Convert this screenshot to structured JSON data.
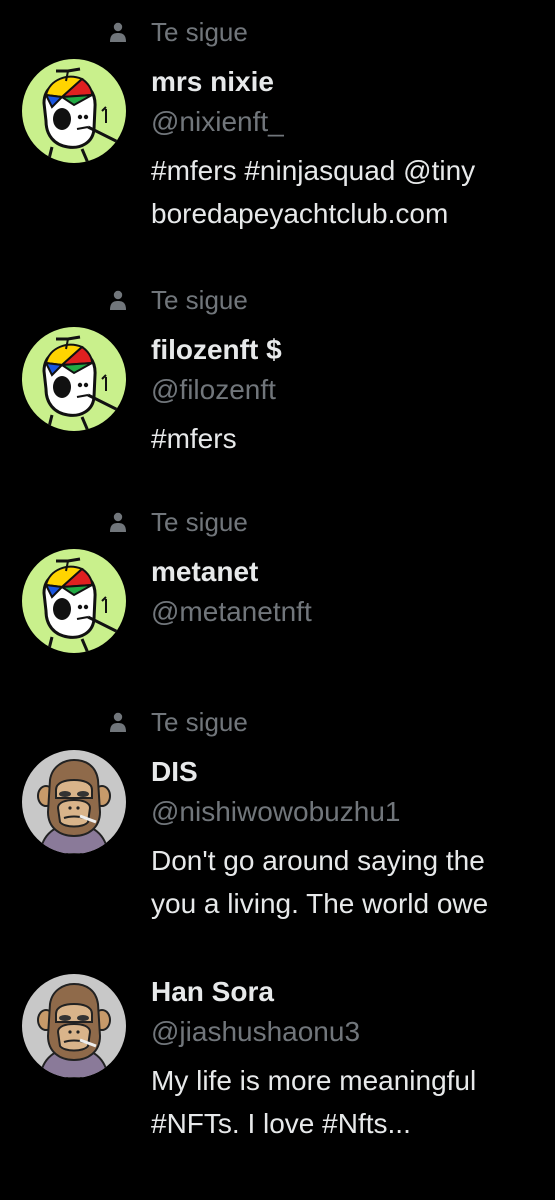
{
  "follows_label": "Te sigue",
  "colors": {
    "background": "#000000",
    "primary_text": "#e7e9ea",
    "secondary_text": "#71767b",
    "mfer_avatar_bg": "#c9f08c",
    "ape_avatar_bg": "#c8c8c8"
  },
  "users": [
    {
      "name": "mrs nixie",
      "handle": "@nixienft_",
      "bio_lines": [
        "#mfers #ninjasquad @tiny",
        "boredapeyachtclub.com"
      ],
      "follows_you": true,
      "avatar": "mfer-avatar"
    },
    {
      "name": "filozenft $",
      "handle": "@filozenft",
      "bio_lines": [
        "#mfers"
      ],
      "follows_you": true,
      "avatar": "mfer-avatar"
    },
    {
      "name": "metanet",
      "handle": "@metanetnft",
      "bio_lines": [],
      "follows_you": true,
      "avatar": "mfer-avatar"
    },
    {
      "name": "DIS",
      "handle": "@nishiwowobuzhu1",
      "bio_lines": [
        "Don't go around saying the",
        "you a living. The world owe"
      ],
      "follows_you": true,
      "avatar": "ape-avatar"
    },
    {
      "name": "Han Sora",
      "handle": "@jiashushaonu3",
      "bio_lines": [
        "My life is more meaningful",
        "#NFTs. I love #Nfts..."
      ],
      "follows_you": false,
      "avatar": "ape-avatar"
    }
  ]
}
